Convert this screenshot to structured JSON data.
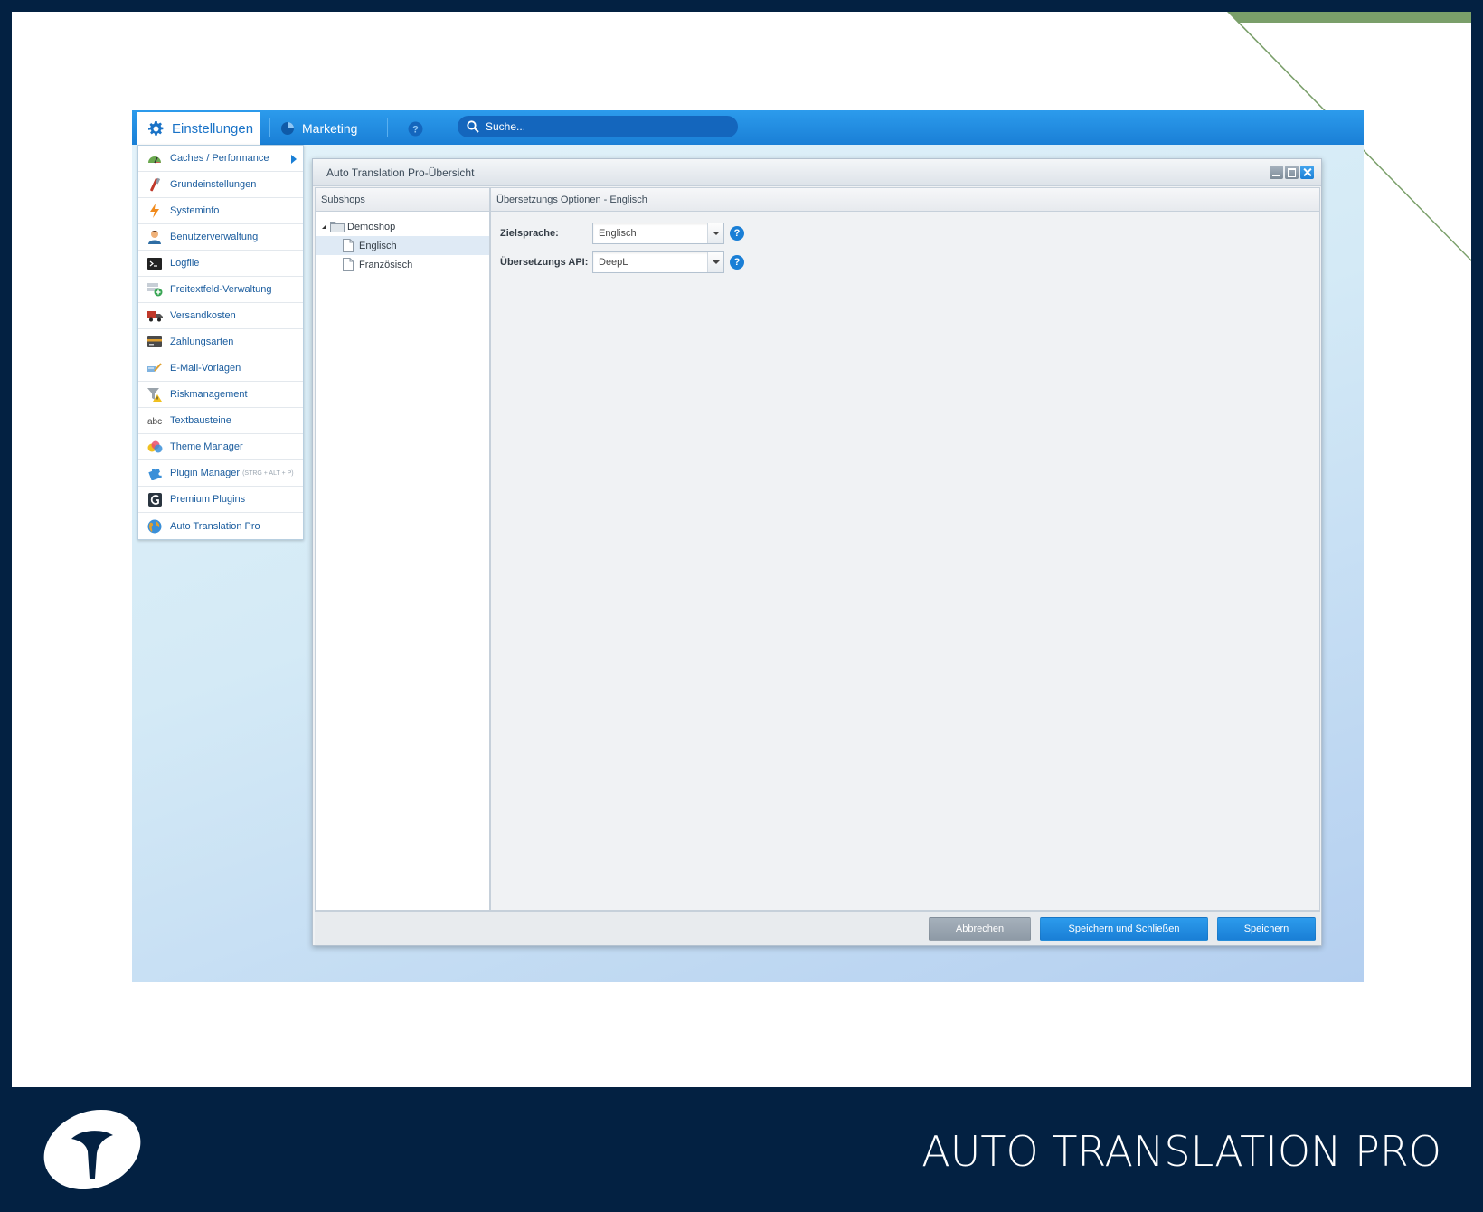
{
  "topbar": {
    "settings_tab": "Einstellungen",
    "marketing_tab": "Marketing",
    "search_placeholder": "Suche..."
  },
  "menu": {
    "items": [
      {
        "label": "Caches / Performance",
        "icon": "speedometer-icon"
      },
      {
        "label": "Grundeinstellungen",
        "icon": "tools-icon"
      },
      {
        "label": "Systeminfo",
        "icon": "lightning-icon"
      },
      {
        "label": "Benutzerverwaltung",
        "icon": "user-icon"
      },
      {
        "label": "Logfile",
        "icon": "terminal-icon"
      },
      {
        "label": "Freitextfeld-Verwaltung",
        "icon": "field-add-icon"
      },
      {
        "label": "Versandkosten",
        "icon": "truck-icon"
      },
      {
        "label": "Zahlungsarten",
        "icon": "credit-card-icon"
      },
      {
        "label": "E-Mail-Vorlagen",
        "icon": "mail-template-icon"
      },
      {
        "label": "Riskmanagement",
        "icon": "filter-warning-icon"
      },
      {
        "label": "Textbausteine",
        "icon": "abc-icon"
      },
      {
        "label": "Theme Manager",
        "icon": "palette-icon"
      },
      {
        "label": "Plugin Manager",
        "icon": "puzzle-icon",
        "shortcut": "(STRG + ALT + P)"
      },
      {
        "label": "Premium Plugins",
        "icon": "premium-icon"
      },
      {
        "label": "Auto Translation Pro",
        "icon": "globe-icon"
      }
    ]
  },
  "window": {
    "title": "Auto Translation Pro-Übersicht",
    "subshops_header": "Subshops",
    "tree": {
      "root": "Demoshop",
      "children": [
        "Englisch",
        "Französisch"
      ]
    },
    "options_header": "Übersetzungs Optionen - Englisch",
    "fields": {
      "target_language_label": "Zielsprache:",
      "target_language_value": "Englisch",
      "api_label": "Übersetzungs API:",
      "api_value": "DeepL"
    },
    "buttons": {
      "cancel": "Abbrechen",
      "save_close": "Speichern und Schließen",
      "save": "Speichern"
    }
  },
  "brand": {
    "product_name": "AUTO TRANSLATION PRO"
  },
  "colors": {
    "accent": "#1a7fd6",
    "navy": "#032142",
    "green": "#7a9f6a"
  }
}
